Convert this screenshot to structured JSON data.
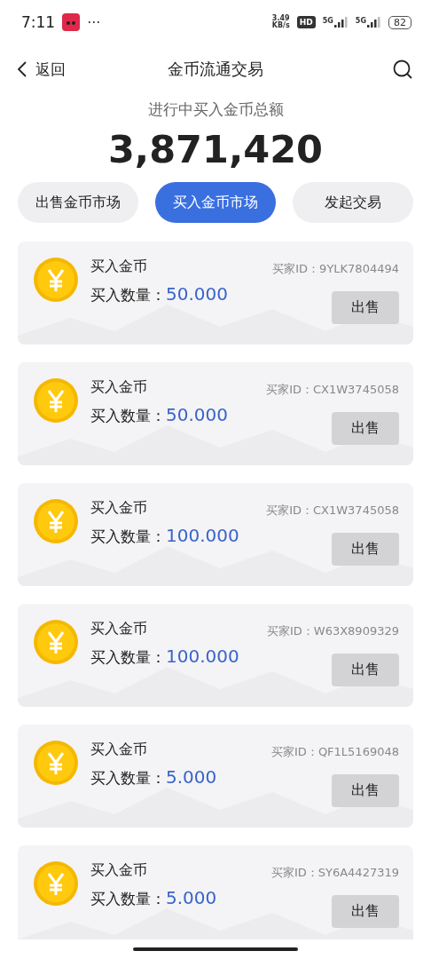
{
  "status_bar": {
    "time": "7:11",
    "more": "···",
    "speed_value": "3.49",
    "speed_unit": "KB/s",
    "hd": "HD",
    "signals": [
      "5G",
      "5G"
    ],
    "battery": "82"
  },
  "header": {
    "back": "返回",
    "title": "金币流通交易"
  },
  "summary": {
    "label": "进行中买入金币总额",
    "total": "3,871,420"
  },
  "tabs": [
    {
      "label": "出售金币市场",
      "selected": false
    },
    {
      "label": "买入金币市场",
      "selected": true
    },
    {
      "label": "发起交易",
      "selected": false
    }
  ],
  "orders": [
    {
      "title": "买入金币",
      "quantity_label": "买入数量：",
      "quantity": "50.000",
      "buyer": "买家ID：9YLK7804494",
      "action": "出售"
    },
    {
      "title": "买入金币",
      "quantity_label": "买入数量：",
      "quantity": "50.000",
      "buyer": "买家ID：CX1W3745058",
      "action": "出售"
    },
    {
      "title": "买入金币",
      "quantity_label": "买入数量：",
      "quantity": "100.000",
      "buyer": "买家ID：CX1W3745058",
      "action": "出售"
    },
    {
      "title": "买入金币",
      "quantity_label": "买入数量：",
      "quantity": "100.000",
      "buyer": "买家ID：W63X8909329",
      "action": "出售"
    },
    {
      "title": "买入金币",
      "quantity_label": "买入数量：",
      "quantity": "5.000",
      "buyer": "买家ID：QF1L5169048",
      "action": "出售"
    },
    {
      "title": "买入金币",
      "quantity_label": "买入数量：",
      "quantity": "5.000",
      "buyer": "买家ID：SY6A4427319",
      "action": "出售"
    }
  ]
}
